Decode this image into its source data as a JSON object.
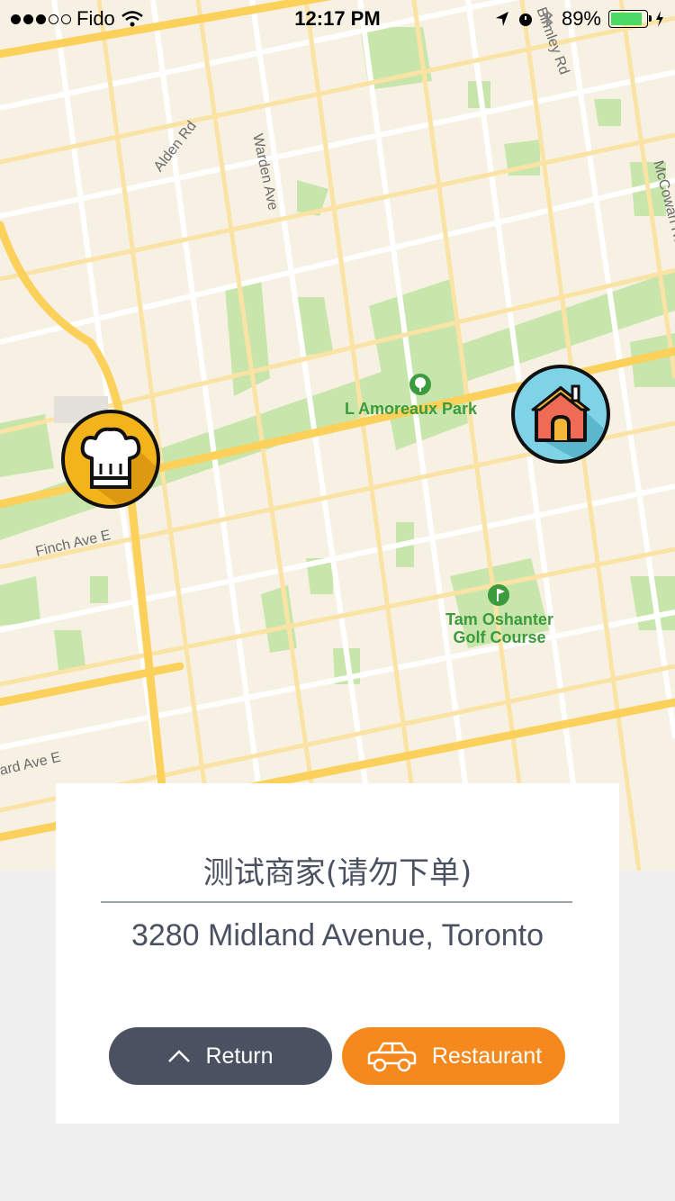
{
  "status_bar": {
    "carrier": "Fido",
    "time": "12:17 PM",
    "battery_percent": "89%",
    "battery_level": 0.89
  },
  "map": {
    "road_labels": [
      "Alden Rd",
      "Warden Ave",
      "Birmley Rd",
      "McCowan Rd",
      "Finch Ave E",
      "ard Ave E"
    ],
    "parks": [
      "L Amoreaux Park",
      "Tam Oshanter Golf Course"
    ],
    "markers": [
      "chef-hat-icon",
      "home-icon"
    ]
  },
  "card": {
    "merchant_name": "测试商家(请勿下单)",
    "address": "3280 Midland Avenue, Toronto",
    "return_label": "Return",
    "restaurant_label": "Restaurant"
  },
  "colors": {
    "map_bg": "#f7f1e4",
    "road_major": "#fbd15c",
    "park": "#c8e6ab",
    "return_button": "#4a5160",
    "restaurant_button": "#f5891e"
  }
}
